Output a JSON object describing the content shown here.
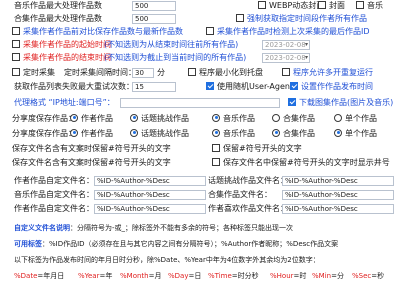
{
  "rows": {
    "r0": {
      "label": "音乐作品最大处理作品数",
      "value": "500",
      "cb1": "WEBP动态封面",
      "cb2": "封面",
      "cb3": "音乐"
    },
    "r1": {
      "label": "合集作品最大处理作品数",
      "value": "500",
      "cb1": "强制获取指定时间段作者所有作品"
    },
    "r2": {
      "cb1": "采集作者作品前对比保存作品数与最新作品数",
      "cb2": "采集作者作品时检测上次采集的最后作品ID"
    },
    "r3": {
      "cb1": "采集作者作品的起始时间",
      "hint": "(不知选则为从结束时间往前所有作品)",
      "date": "2023-02-08"
    },
    "r4": {
      "cb1": "采集作者作品的结束时间",
      "hint": "(不知选则为截止到当前时间的所有作品)",
      "date": "2023-02-08"
    },
    "r5": {
      "cb1": "定时采集",
      "label2": "定时采集间隔时间：",
      "value": "30",
      "unit": "分",
      "cb2": "程序最小化到托盘",
      "cb3": "程序允许多开重复运行"
    },
    "r6": {
      "label": "获取作品列表失败最大重试次数：",
      "value": "15",
      "cb1": "使用随机User-Agent",
      "cb2": "设置作作品发布时间"
    },
    "r7": {
      "label": "代理格式 “IP地址:端口号”：",
      "cb1": "下载图集作品(图片及音乐)"
    },
    "r8": {
      "label": "分享度保存作品：",
      "opts": [
        "作者作品",
        "话题挑战作品",
        "音乐作品",
        "合集作品",
        "单个作品"
      ]
    },
    "r9": {
      "label": "分享度保存作品：",
      "opts": [
        "作者作品",
        "话题挑战作品",
        "音乐作品",
        "合集作品",
        "单个作品"
      ]
    },
    "r10": {
      "label": "保存文件名含有文案时保留#符号开头的文字",
      "cb1": "保留#符号开头的文字"
    },
    "r11": {
      "label": "保存文件名含有文案时保留#符号开头的文字",
      "cb1": "保存文件名中保留#符号开头的文字时显示井号"
    },
    "r12": {
      "label": "作者作品自定文件名：",
      "tpl1": "%ID-%Author-%Desc",
      "label2": "话题挑战作品文件名：",
      "tpl2": "%ID-%Author-%Desc"
    },
    "r13": {
      "label": "音乐作品自定文件名：",
      "tpl1": "%ID-%Author-%Desc",
      "label2": "合集作品文件名：",
      "tpl2": "%ID-%Author-%Desc"
    },
    "r14": {
      "label": "作者作品自定文件名：",
      "tpl1": "%ID-%Author-%Desc",
      "label2": "作者喜欢作品文件名：",
      "tpl2": "%ID-%Author-%Desc"
    }
  },
  "notes": {
    "n1_title": "自定义文件名说明",
    "n1_body": "：分隔符号为-或_；除标签外不能有多余的符号；各种标签只能出现一次",
    "n2_title": "可用标签",
    "n2_body": "：%ID作品ID（必须存在且与其它内容之间有分隔符号）；%Author作者昵称；%Desc作品文案",
    "n3": "以下标签为作品发布时间的年月日时分秒，除%Date、%Year中年为4位数字外其余均为2位数字：",
    "tags": [
      {
        "k": "%Date",
        "v": "年月日"
      },
      {
        "k": "%Year",
        "v": "年"
      },
      {
        "k": "%Month",
        "v": "月"
      },
      {
        "k": "%Day",
        "v": "日"
      },
      {
        "k": "%Time",
        "v": "时分秒"
      },
      {
        "k": "%Hour",
        "v": "时"
      },
      {
        "k": "%Min",
        "v": "分"
      },
      {
        "k": "%Sec",
        "v": "秒"
      }
    ]
  },
  "colors": {
    "accent": "#1f6fe0",
    "title_blue": "#1f4fd6",
    "note_red": "#e02020"
  }
}
